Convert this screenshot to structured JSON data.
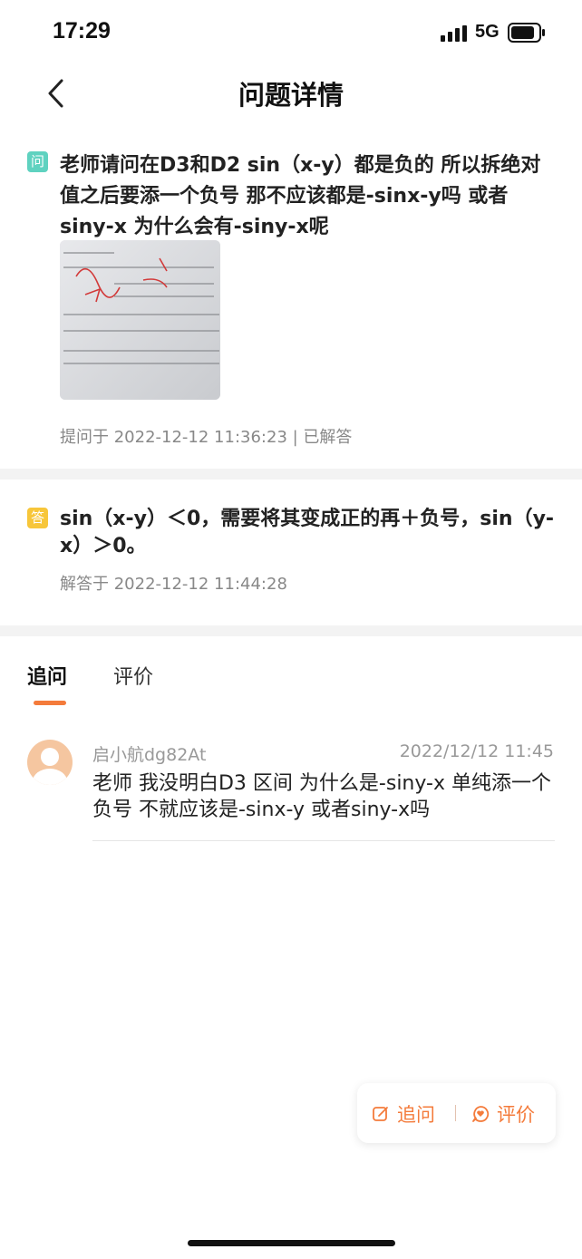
{
  "status_bar": {
    "time": "17:29",
    "network": "5G"
  },
  "nav": {
    "title": "问题详情"
  },
  "question": {
    "tag": "问",
    "text": "老师请问在D3和D2  sin（x-y）都是负的  所以拆绝对值之后要添一个负号  那不应该都是-sinx-y吗 或者siny-x 为什么会有-siny-x呢",
    "meta": "提问于 2022-12-12 11:36:23 | 已解答"
  },
  "answer": {
    "tag": "答",
    "text": "sin（x-y）＜0，需要将其变成正的再＋负号，sin（y-x）＞0。",
    "meta": "解答于 2022-12-12 11:44:28"
  },
  "tabs": [
    "追问",
    "评价"
  ],
  "comments": [
    {
      "name": "启小航dg82At",
      "date": "2022/12/12 11:45",
      "text": "老师 我没明白D3 区间 为什么是-siny-x 单纯添一个负号 不就应该是-sinx-y 或者siny-x吗"
    }
  ],
  "float_bar": {
    "followup_label": "追问",
    "rate_label": "评价"
  },
  "colors": {
    "accent": "#f47b3b",
    "question_tag": "#5fd2c0",
    "answer_tag": "#f7c63a"
  },
  "icons": {
    "back": "chevron-left-icon",
    "followup": "edit-icon",
    "rate": "heart-chat-icon"
  }
}
